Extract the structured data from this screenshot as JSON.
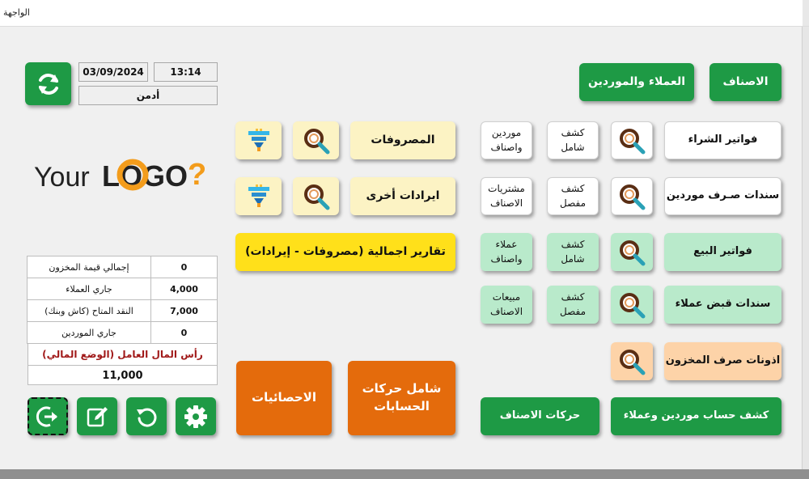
{
  "window": {
    "title": "الواجهة"
  },
  "header": {
    "date": "03/09/2024",
    "time": "13:14",
    "user": "أدمن"
  },
  "logo": {
    "text_your": "Your",
    "text_logo": "LOGO",
    "text_q": "?"
  },
  "top_buttons": {
    "items": "الاصناف",
    "customers_suppliers": "العملاء والموردين"
  },
  "purchase": {
    "invoices": "فواتير الشراء",
    "summary_line1": "كشف",
    "summary_line2": "شامل",
    "suppliers_items_line1": "موردين",
    "suppliers_items_line2": "واصناف"
  },
  "supplier_payment": {
    "label": "سندات صـرف موردين",
    "detail_line1": "كشف",
    "detail_line2": "مفصل",
    "items_purchases_line1": "مشتريات",
    "items_purchases_line2": "الاصناف"
  },
  "sales": {
    "invoices": "فواتير البيع",
    "summary_line1": "كشف",
    "summary_line2": "شامل",
    "customers_items_line1": "عملاء",
    "customers_items_line2": "واصناف"
  },
  "customer_receipt": {
    "label": "سندات قبض عملاء",
    "detail_line1": "كشف",
    "detail_line2": "مفصل",
    "items_sales_line1": "مبيعات",
    "items_sales_line2": "الاصناف"
  },
  "stock_issue": {
    "label": "اذونات صرف المخزون"
  },
  "bottom_green": {
    "account_statement": "كشف حساب موردين وعملاء",
    "item_movements": "حركات الاصناف"
  },
  "expenses": {
    "label": "المصروفات"
  },
  "other_income": {
    "label": "ايرادات أخرى"
  },
  "summary_reports": {
    "label": "تقارير اجمالية (مصروفات - إيرادات)"
  },
  "orange": {
    "accounts_line1": "شامل حركات",
    "accounts_line2": "الحسابات",
    "statistics": "الاحصائيات"
  },
  "stats": {
    "rows": [
      {
        "label": "إجمالي قيمة المخزون",
        "value": "0"
      },
      {
        "label": "جاري العملاء",
        "value": "4,000"
      },
      {
        "label": "النقد المتاح (كاش وبنك)",
        "value": "7,000"
      },
      {
        "label": "جاري الموردين",
        "value": "0"
      }
    ],
    "capital_label": "رأس المال العامل (الوضع المالي)",
    "capital_value": "11,000"
  },
  "icons": {
    "refresh": "refresh-arrows-icon",
    "search": "magnifier-icon",
    "filter": "funnel-filter-icon",
    "exit": "exit-icon",
    "edit": "edit-icon",
    "reset": "reset-icon",
    "settings": "gear-icon"
  },
  "colors": {
    "green": "#1e9a45",
    "mint": "#b9eacb",
    "cream": "#fcf3c4",
    "yellow": "#ffe01a",
    "peach": "#fdd3a8",
    "orange": "#e46b0c"
  }
}
